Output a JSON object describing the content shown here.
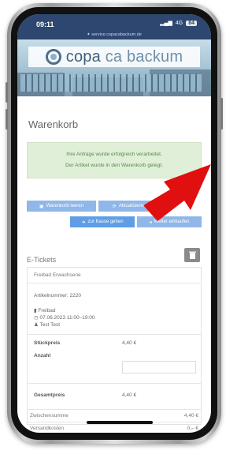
{
  "status": {
    "time": "09:11",
    "network": "4G",
    "battery": "84"
  },
  "browser": {
    "url": "✦ service.copacabackum.de"
  },
  "header": {
    "brand_main": "copa",
    "brand_light": "ca backum"
  },
  "page": {
    "title": "Warenkorb"
  },
  "alert": {
    "line1": "Ihre Anfrage wurde erfolgreich verarbeitet.",
    "line2": "Der Artikel wurde in den Warenkorb gelegt."
  },
  "buttons": {
    "top": [
      "Warenkorb leeren",
      "Aktualisieren"
    ],
    "bottom": [
      "zur Kasse gehen",
      "Weiter einkaufen"
    ]
  },
  "section": {
    "title": "E-Tickets"
  },
  "item": {
    "name": "Freibad Erwachsene",
    "article_no": "Artikelnummer: 2220",
    "venue": "Freibad",
    "date": "07.06.2023 11:00–19:00",
    "person": "Test Test",
    "unit_price_label": "Stückpreis",
    "unit_price": "4,40 €",
    "qty_label": "Anzahl",
    "total_label": "Gesamtpreis",
    "total": "4,40 €"
  },
  "totals": [
    {
      "label": "Zwischensumme",
      "value": "4,40 €"
    },
    {
      "label": "Versandkosten",
      "value": "0,– €"
    }
  ],
  "colors": {
    "status_bar": "#2e4770",
    "button": "#8fb7e8",
    "alert_bg": "#dfefd8",
    "arrow": "#e01010"
  }
}
